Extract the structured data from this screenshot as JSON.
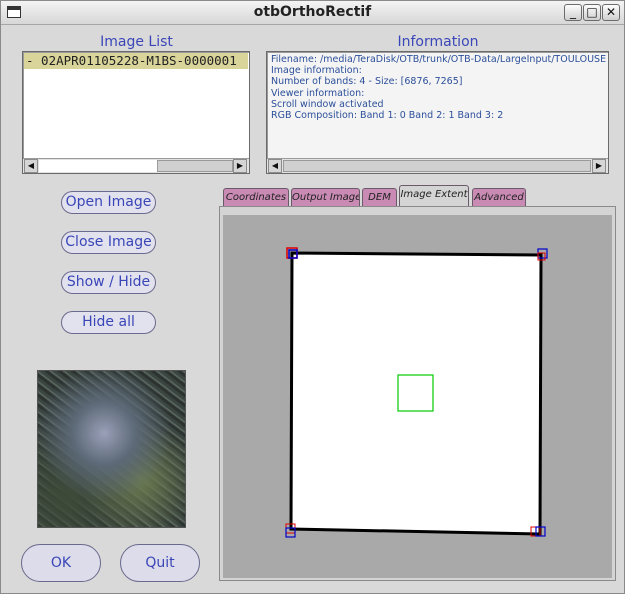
{
  "window": {
    "title": "otbOrthoRectif",
    "buttons": {
      "minimize": "_",
      "maximize": "□",
      "close": "✕"
    }
  },
  "image_list": {
    "label": "Image List",
    "items": [
      "- 02APR01105228-M1BS-0000001"
    ]
  },
  "information": {
    "label": "Information",
    "lines": [
      "Filename: /media/TeraDisk/OTB/trunk/OTB-Data/LargeInput/TOULOUSE/(",
      "Image information:",
      "Number of bands: 4 - Size: [6876, 7265]",
      "Viewer information:",
      "Scroll window activated",
      "RGB Composition:  Band 1: 0 Band 2: 1 Band 3: 2"
    ]
  },
  "scrollbar": {
    "left_arrow": "◀",
    "right_arrow": "▶"
  },
  "actions": {
    "open_image": "Open Image",
    "close_image": "Close Image",
    "show_hide": "Show / Hide",
    "hide_all": "Hide all",
    "ok": "OK",
    "quit": "Quit"
  },
  "tabs": [
    {
      "label": "Coordinates",
      "active": false
    },
    {
      "label": "Output Image",
      "active": false
    },
    {
      "label": "DEM",
      "active": false
    },
    {
      "label": "Image Extent",
      "active": true
    },
    {
      "label": "Advanced",
      "active": false
    }
  ],
  "colors": {
    "label_blue": "#3a46b8",
    "info_text": "#2c4f9a",
    "list_selection": "#d8d49a",
    "tab_inactive": "#c98ab4",
    "extent_roi": "#00cc00",
    "corner_red": "#e00000",
    "corner_blue": "#0000cc"
  }
}
